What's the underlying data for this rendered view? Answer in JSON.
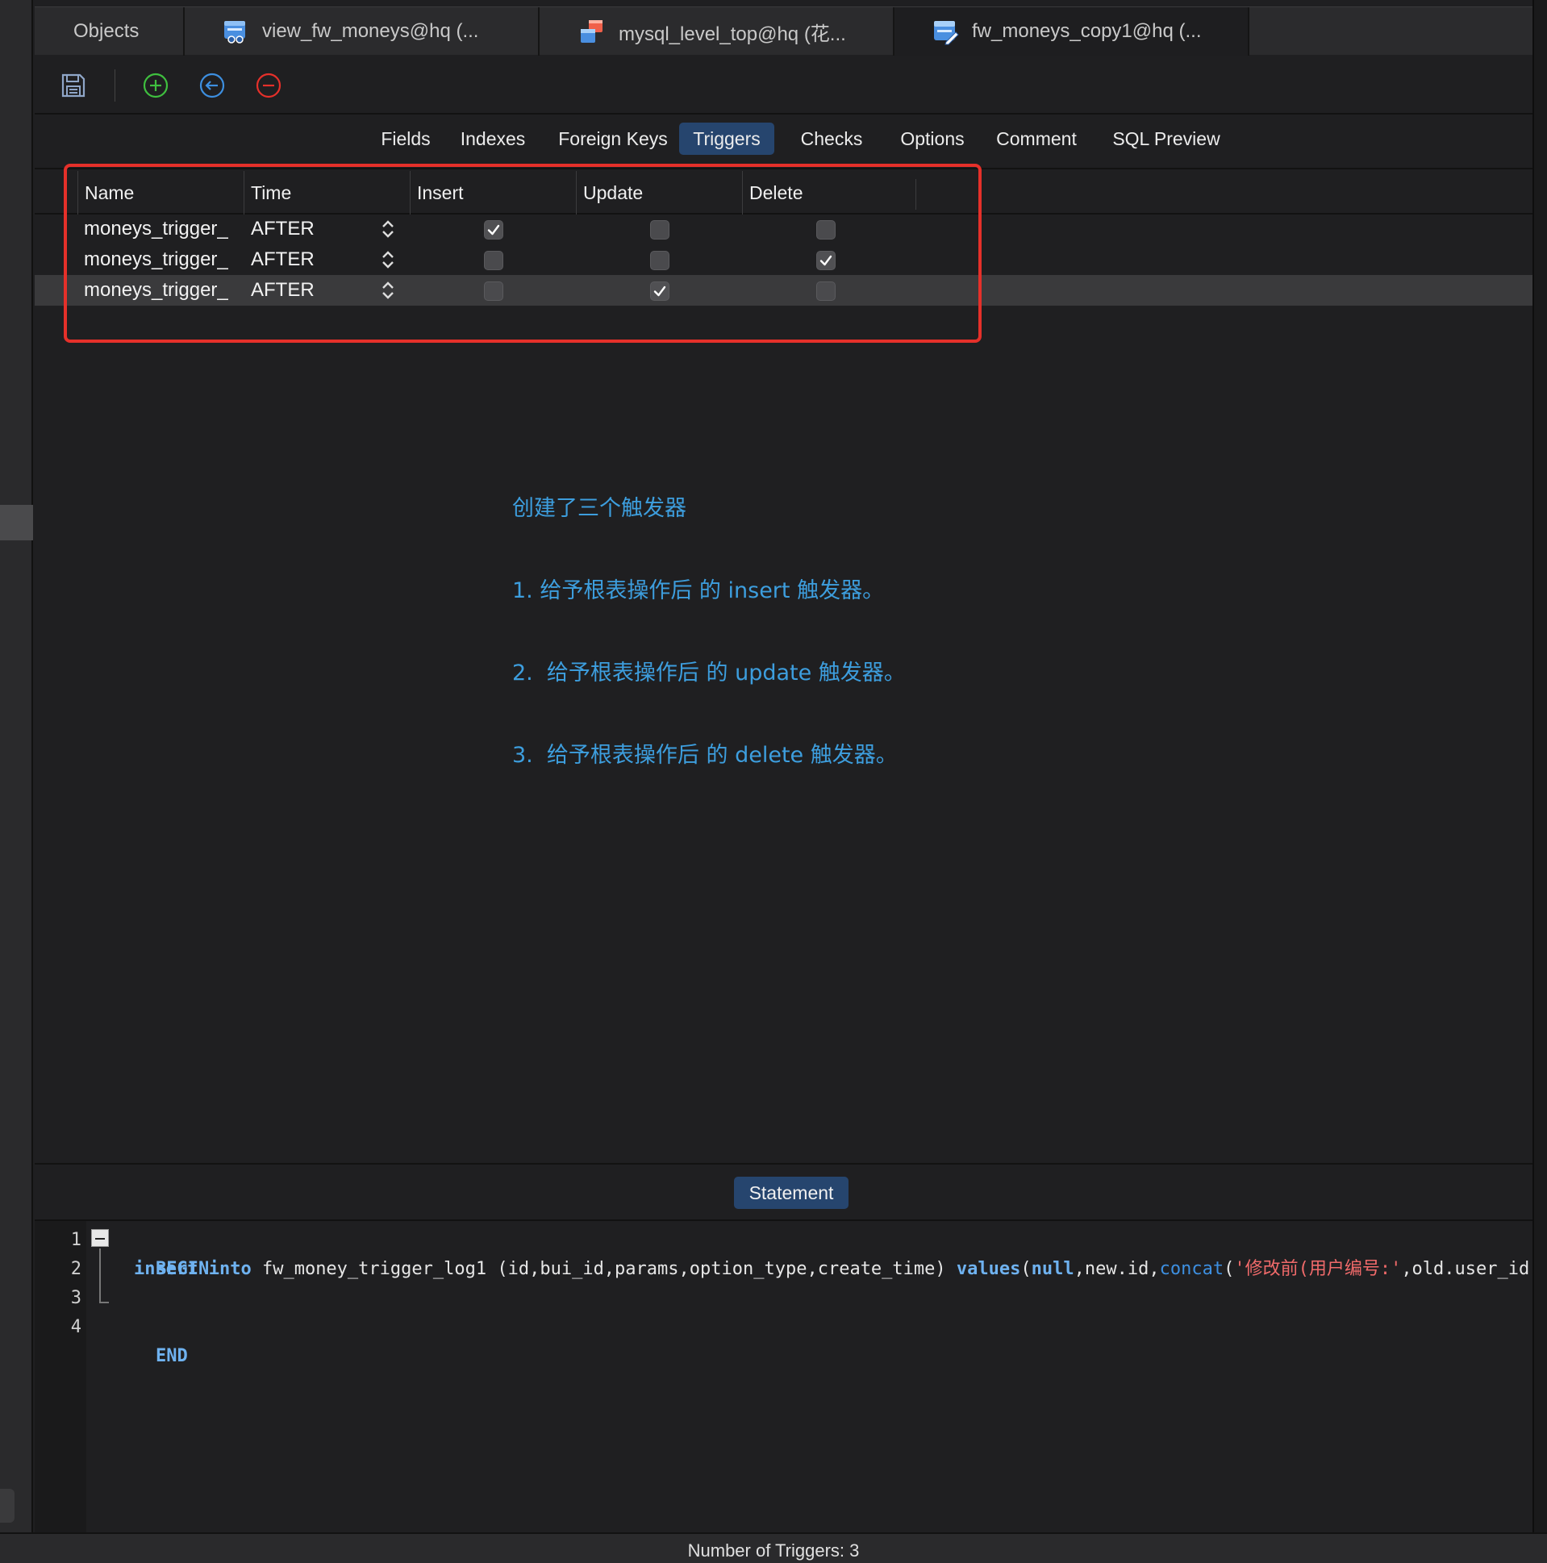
{
  "tabs": [
    {
      "label": "Objects",
      "icon": null
    },
    {
      "label": "view_fw_moneys@hq (...",
      "icon": "view-icon"
    },
    {
      "label": "mysql_level_top@hq (花...",
      "icon": "query-icon"
    },
    {
      "label": "fw_moneys_copy1@hq (...",
      "icon": "table-design-icon"
    }
  ],
  "toolbar": {
    "save_icon": "save-icon",
    "add_icon": "add-circle-icon",
    "insert_icon": "insert-left-circle-icon",
    "delete_icon": "remove-circle-icon",
    "colors": {
      "add": "#3fbf3f",
      "insert": "#3d8fe0",
      "delete": "#e5302a"
    }
  },
  "subtabs": [
    "Fields",
    "Indexes",
    "Foreign Keys",
    "Triggers",
    "Checks",
    "Options",
    "Comment",
    "SQL Preview"
  ],
  "active_subtab": "Triggers",
  "grid": {
    "columns": [
      "Name",
      "Time",
      "Insert",
      "Update",
      "Delete"
    ],
    "rows": [
      {
        "name": "moneys_trigger_",
        "time": "AFTER",
        "insert": true,
        "update": false,
        "delete": false
      },
      {
        "name": "moneys_trigger_",
        "time": "AFTER",
        "insert": false,
        "update": false,
        "delete": true
      },
      {
        "name": "moneys_trigger_",
        "time": "AFTER",
        "insert": false,
        "update": true,
        "delete": false
      }
    ],
    "selected_row": 2
  },
  "annotation": {
    "line1": "创建了三个触发器",
    "line2": "1. 给予根表操作后 的 insert 触发器。",
    "line3": "2.  给予根表操作后 的 update 触发器。",
    "line4": "3.  给予根表操作后 的 delete 触发器。",
    "color": "#3d9ede"
  },
  "highlight_color": "#e5302a",
  "statement": {
    "tab_label": "Statement",
    "line_numbers": [
      "1",
      "2",
      "3",
      "4"
    ],
    "line1": "BEGIN",
    "line2": {
      "kw_insert": "insert",
      "kw_into": "into",
      "table": " fw_money_trigger_log1 (id,bui_id,params,option_type,create_time) ",
      "kw_values": "values",
      "open": "(",
      "kw_null": "null",
      "middle": ",new.id,",
      "fn_concat": "concat",
      "open2": "(",
      "string": "'修改前(用户编号:'",
      "rest": ",old.user_id,"
    },
    "line4": "END"
  },
  "status": {
    "text": "Number of Triggers: 3"
  }
}
